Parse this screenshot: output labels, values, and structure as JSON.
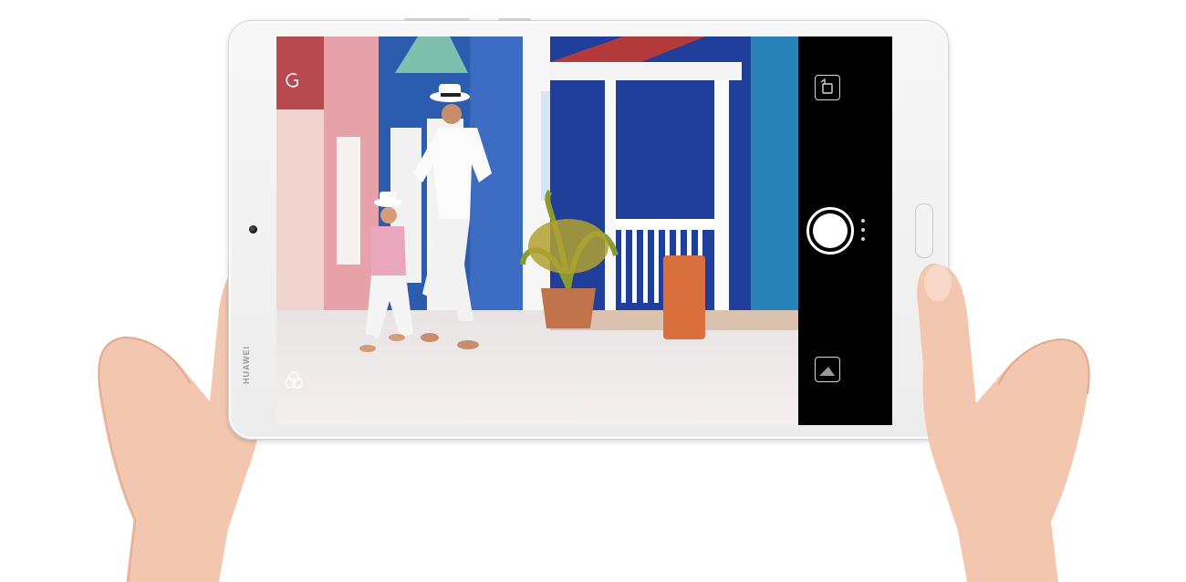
{
  "device": {
    "brand": "HUAWEI",
    "body_color": "#efefef",
    "screen_color": "#000000"
  },
  "camera_app": {
    "viewfinder": {
      "scene": "photo-preview",
      "top_left_icon": "mode-icon",
      "bottom_left_icon": "filter-icon"
    },
    "controls": {
      "switch_camera_icon": "switch-camera-icon",
      "shutter_icon": "shutter-icon",
      "more_icon": "more-dots-icon",
      "gallery_icon": "gallery-thumbnail-icon"
    },
    "accent": "#ffffff"
  }
}
